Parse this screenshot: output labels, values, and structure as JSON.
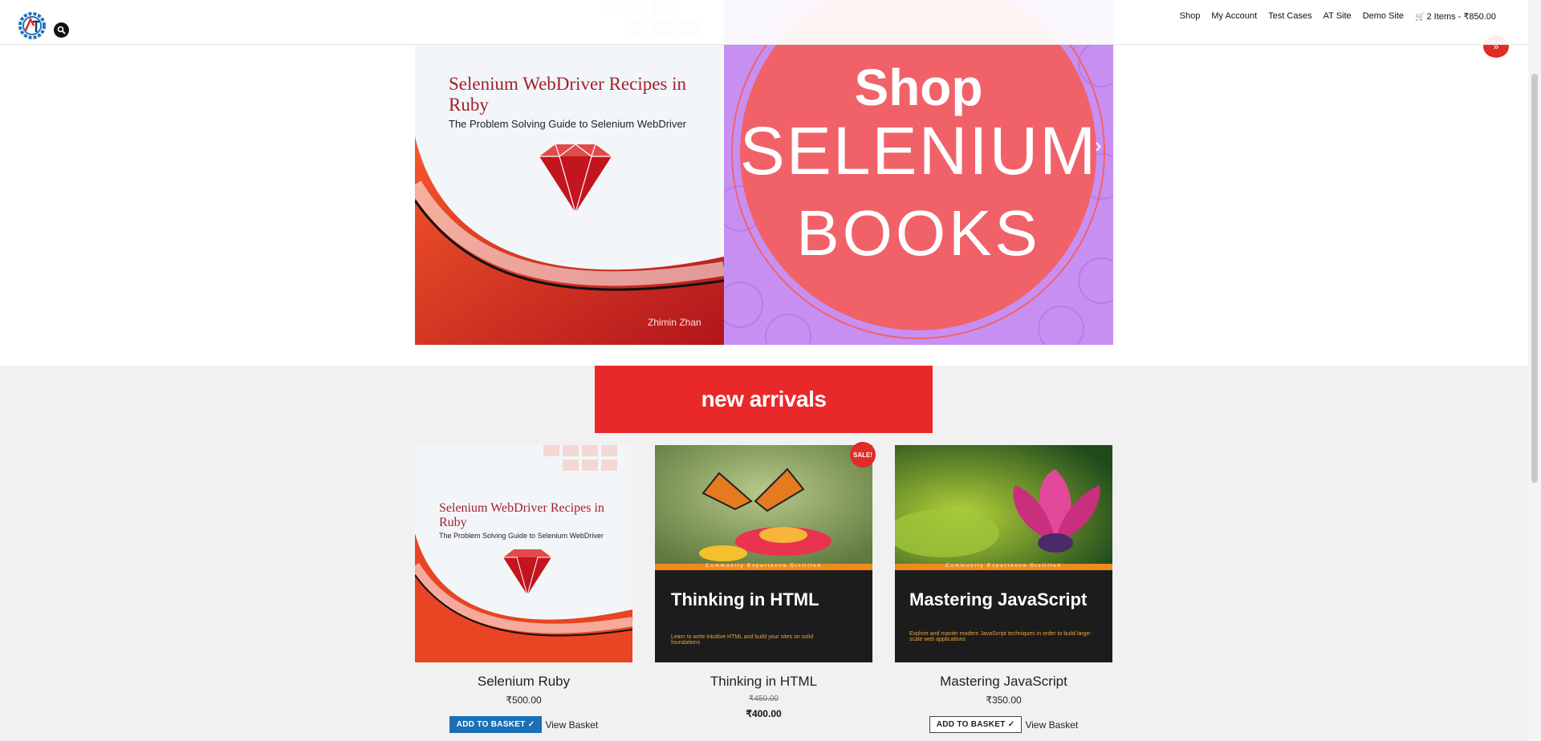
{
  "header": {
    "logo_text": "AT",
    "nav": [
      "Shop",
      "My Account",
      "Test Cases",
      "AT Site",
      "Demo Site"
    ],
    "cart_label": "2 Items - ₹850.00"
  },
  "hero": {
    "book_title": "Selenium WebDriver Recipes in Ruby",
    "book_subtitle": "The Problem Solving Guide to Selenium WebDriver",
    "book_author": "Zhimin Zhan",
    "shop_line1": "Shop",
    "shop_line2": "SELENIUM",
    "shop_line3": "BOOKS",
    "next_arrow": "›",
    "scroll_top": "»"
  },
  "section": {
    "heading": "new arrivals"
  },
  "products": [
    {
      "title": "Selenium Ruby",
      "price": "₹500.00",
      "button": "ADD TO BASKET",
      "view_basket": "View Basket",
      "cover_title": "Selenium WebDriver Recipes in Ruby",
      "cover_subtitle": "The Problem Solving Guide to Selenium WebDriver"
    },
    {
      "title": "Thinking in HTML",
      "price_old": "₹450.00",
      "price_new": "₹400.00",
      "sale_badge": "SALE!",
      "cover_band": "Community Experience Distilled",
      "cover_title": "Thinking in HTML",
      "cover_text": "Learn to write intuitive HTML and build your sites on solid foundations"
    },
    {
      "title": "Mastering JavaScript",
      "price": "₹350.00",
      "button": "ADD TO BASKET",
      "view_basket": "View Basket",
      "cover_band": "Community Experience Distilled",
      "cover_title": "Mastering JavaScript",
      "cover_text": "Explore and master modern JavaScript techniques in order to build large-scale web applications"
    }
  ]
}
